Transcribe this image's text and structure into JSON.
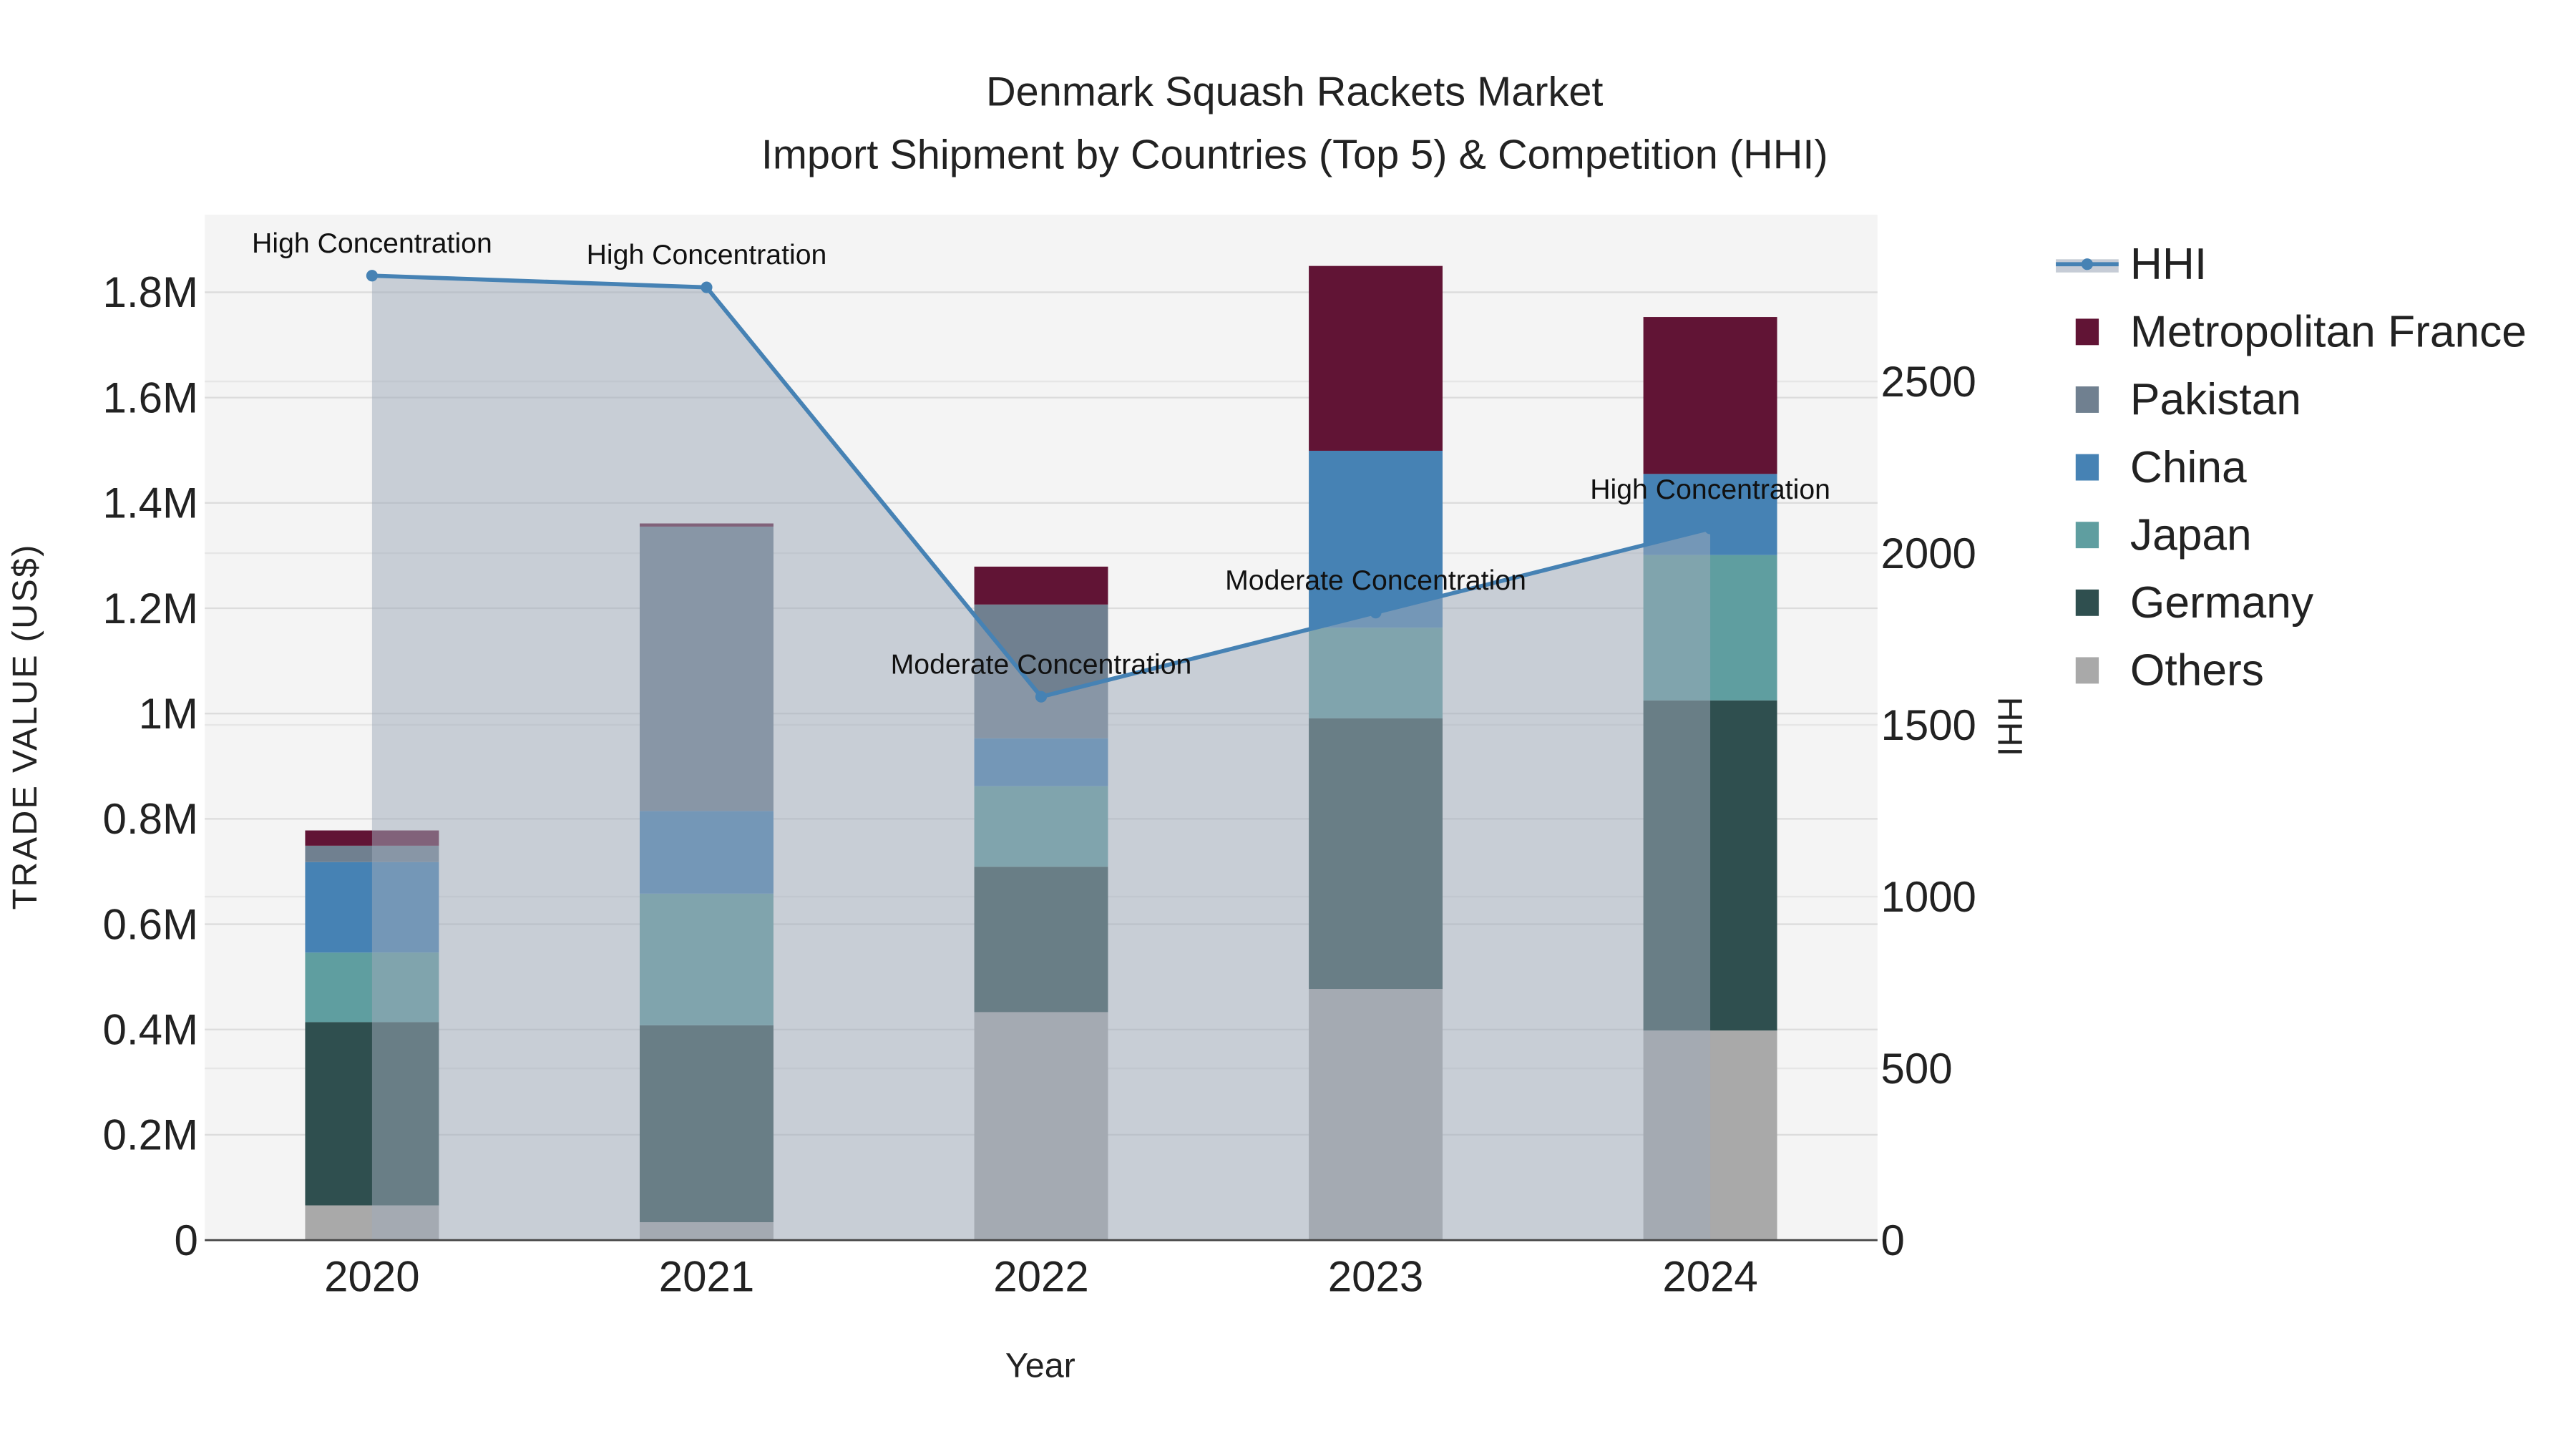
{
  "chart_data": {
    "type": "bar",
    "stacked": true,
    "title": "Denmark Squash Rackets Market",
    "subtitle": "Import Shipment by Countries (Top 5) & Competition (HHI)",
    "xlabel": "Year",
    "ylabel": "TRADE VALUE (US$)",
    "y2label": "HHI",
    "categories": [
      "2020",
      "2021",
      "2022",
      "2023",
      "2024"
    ],
    "ylim": [
      0,
      1940000
    ],
    "y2lim": [
      0,
      2990
    ],
    "yticks": [
      0,
      200000,
      400000,
      600000,
      800000,
      1000000,
      1200000,
      1400000,
      1600000,
      1800000
    ],
    "ytick_labels": [
      "0",
      "0.2M",
      "0.4M",
      "0.6M",
      "0.8M",
      "1M",
      "1.2M",
      "1.4M",
      "1.6M",
      "1.8M"
    ],
    "y2ticks": [
      0,
      500,
      1000,
      1500,
      2000,
      2500
    ],
    "y2tick_labels": [
      "0",
      "500",
      "1000",
      "1500",
      "2000",
      "2500"
    ],
    "series": [
      {
        "name": "Others",
        "color": "#a9a9a9",
        "values": [
          66000,
          34000,
          433000,
          477000,
          398000
        ]
      },
      {
        "name": "Germany",
        "color": "#2f4f4f",
        "values": [
          348000,
          374000,
          276000,
          514000,
          627000
        ]
      },
      {
        "name": "Japan",
        "color": "#5f9ea0",
        "values": [
          132000,
          250000,
          153000,
          172000,
          276000
        ]
      },
      {
        "name": "China",
        "color": "#4682b4",
        "values": [
          172000,
          157000,
          91000,
          336000,
          154000
        ]
      },
      {
        "name": "Pakistan",
        "color": "#708090",
        "values": [
          31000,
          540000,
          254000,
          0,
          0
        ]
      },
      {
        "name": "Metropolitan France",
        "color": "#611435",
        "values": [
          29000,
          6000,
          72000,
          351000,
          298000
        ]
      }
    ],
    "hhi": {
      "name": "HHI",
      "color": "#4682b4",
      "values": [
        2808,
        2774,
        1582,
        1827,
        2072
      ]
    },
    "annotations": [
      "High Concentration",
      "High Concentration",
      "Moderate Concentration",
      "Moderate Concentration",
      "High Concentration"
    ],
    "legend": [
      "HHI",
      "Metropolitan France",
      "Pakistan",
      "China",
      "Japan",
      "Germany",
      "Others"
    ],
    "legend_position": "right",
    "grid": true
  }
}
